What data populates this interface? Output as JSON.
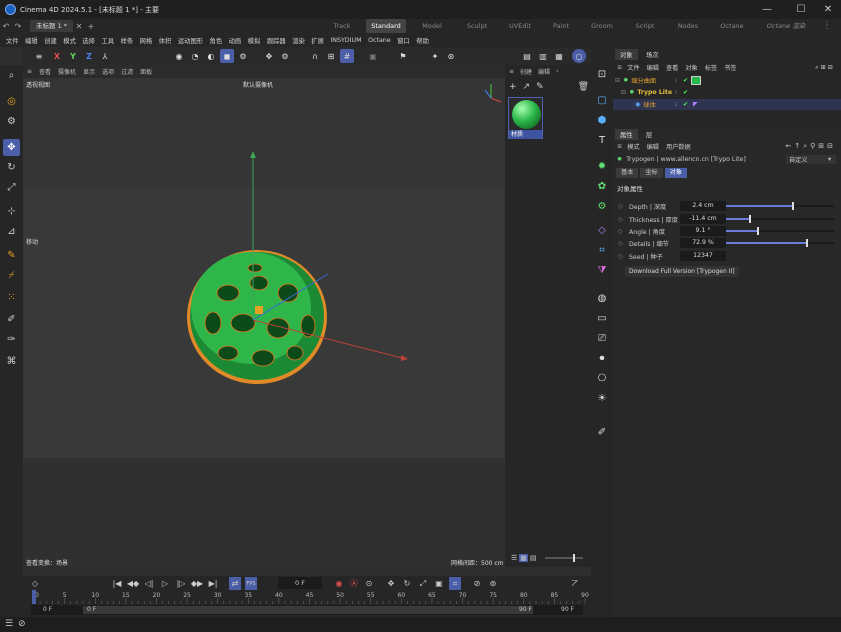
{
  "window": {
    "title": "Cinema 4D 2024.5.1 - [未标题 1 *] - 主要",
    "min": "—",
    "max": "☐",
    "close": "✕"
  },
  "tabs": {
    "doc": "未标题 1 *",
    "add": "+",
    "workspaces": [
      "Track",
      "Standard",
      "Model",
      "Sculpt",
      "UVEdit",
      "Paint",
      "Groom",
      "Script",
      "Nodes",
      "Octane",
      "Octane 渲染"
    ]
  },
  "menu": [
    "文件",
    "编辑",
    "创建",
    "模式",
    "选择",
    "工具",
    "样条",
    "网格",
    "体积",
    "运动图形",
    "角色",
    "动画",
    "模拟",
    "跟踪器",
    "渲染",
    "扩展",
    "INSYDIUM",
    "Octane",
    "窗口",
    "帮助"
  ],
  "toolbar": {
    "x": "X",
    "y": "Y",
    "z": "Z"
  },
  "viewport": {
    "menu": [
      "查看",
      "摄像机",
      "显示",
      "选项",
      "过滤",
      "面板"
    ],
    "name": "透视视图",
    "camera": "默认摄像机",
    "move_label": "移动",
    "status_left": "查看变换：场景",
    "grid": "网格间距：500 cm"
  },
  "materials": {
    "menu": [
      "创建",
      "编辑"
    ],
    "item": "材质"
  },
  "objects": {
    "tabs": [
      "对象",
      "场次"
    ],
    "menu": [
      "文件",
      "编辑",
      "查看",
      "对象",
      "标签",
      "书签"
    ],
    "rows": [
      {
        "name": "细分曲面",
        "color": "#e0a030"
      },
      {
        "name": "Trypo Lite",
        "color": "#e8c040"
      },
      {
        "name": "球体",
        "color": "#e0a030"
      }
    ]
  },
  "attributes": {
    "tabs": [
      "属性",
      "层"
    ],
    "menu": [
      "模式",
      "编辑",
      "用户数据"
    ],
    "title": "Trypogen | www.allencn.cn [Trypo Lite]",
    "preset": "自定义",
    "subtabs": [
      "基本",
      "坐标",
      "对象"
    ],
    "section": "对象属性",
    "params": [
      {
        "name": "Depth | 深度",
        "value": "2.4 cm",
        "level": 0.62
      },
      {
        "name": "Thickness | 厚度",
        "value": "-11.4 cm",
        "level": 0.22
      },
      {
        "name": "Angle | 角度",
        "value": "9.1 °",
        "level": 0.3
      },
      {
        "name": "Details | 细节",
        "value": "72.9 %",
        "level": 0.75
      },
      {
        "name": "Seed | 种子",
        "value": "12347",
        "level": null
      }
    ],
    "button": "Download Full Version [Trypogen II]"
  },
  "timeline": {
    "frame": "0 F",
    "ticks": [
      "0",
      "5",
      "10",
      "15",
      "20",
      "25",
      "30",
      "35",
      "40",
      "45",
      "50",
      "55",
      "60",
      "65",
      "70",
      "75",
      "80",
      "85",
      "90"
    ],
    "start": "0 F",
    "start2": "0 F",
    "end": "90 F",
    "end2": "90 F"
  },
  "colors": {
    "accent": "#4a5fa8",
    "object_green": "#2bb84a",
    "axis_y": "#3fa35a",
    "axis_x": "#c0403a",
    "axis_z": "#3a6ad0",
    "selection": "#e87a20"
  }
}
